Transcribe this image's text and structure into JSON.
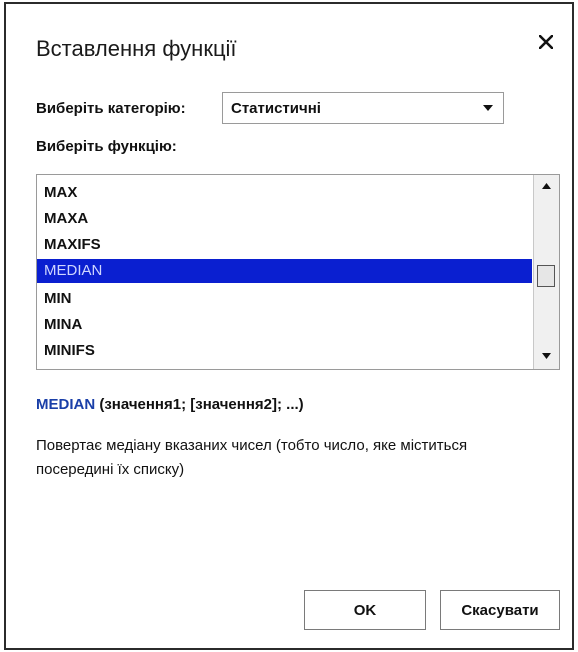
{
  "dialog": {
    "title": "Вставлення функції",
    "close_icon": "close-icon"
  },
  "category": {
    "label": "Виберіть категорію:",
    "selected": "Статистичні"
  },
  "functions": {
    "label": "Виберіть функцію:",
    "items": [
      "MAX",
      "MAXA",
      "MAXIFS",
      "MEDIAN",
      "MIN",
      "MINA",
      "MINIFS"
    ],
    "selected": "MEDIAN"
  },
  "syntax": {
    "name": "MEDIAN",
    "args": " (значення1; [значення2]; ...)"
  },
  "description": "Повертає медіану вказаних чисел (тобто число, яке міститься посередині їх списку)",
  "buttons": {
    "ok": "OK",
    "cancel": "Скасувати"
  },
  "colors": {
    "selection": "#0a1fd0",
    "function_name": "#1a3fa8"
  }
}
